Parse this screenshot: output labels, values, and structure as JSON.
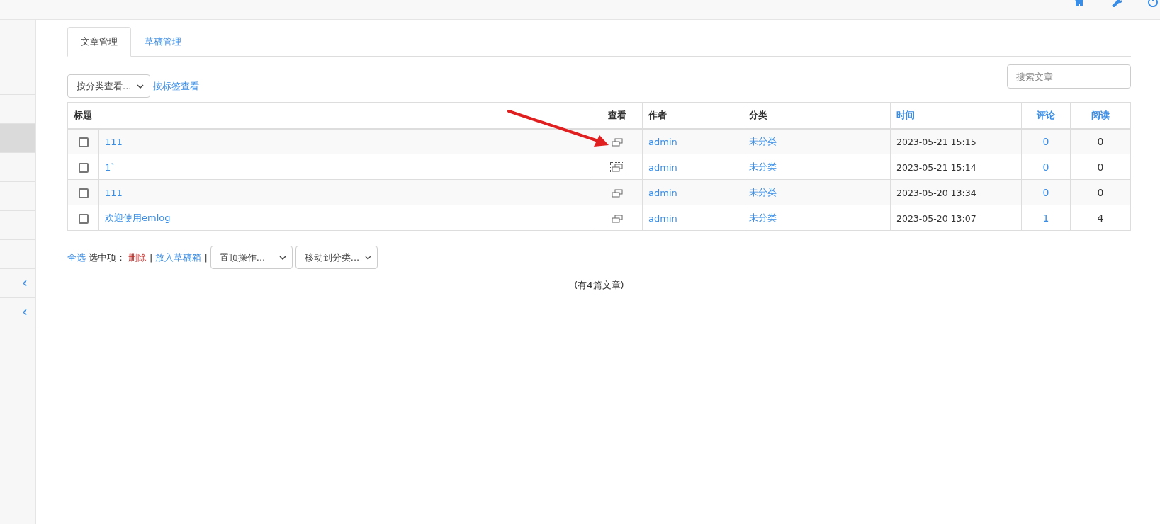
{
  "sidebar": {
    "items": [
      {
        "selected": false,
        "expandable": false
      },
      {
        "selected": true,
        "expandable": false
      },
      {
        "selected": false,
        "expandable": false
      },
      {
        "selected": false,
        "expandable": false
      },
      {
        "selected": false,
        "expandable": false
      },
      {
        "selected": false,
        "expandable": false
      },
      {
        "selected": false,
        "expandable": true
      },
      {
        "selected": false,
        "expandable": true
      }
    ]
  },
  "tabs": [
    {
      "label": "文章管理",
      "selected": true
    },
    {
      "label": "草稿管理",
      "selected": false
    }
  ],
  "filters": {
    "category_select": "按分类查看...",
    "tag_link": "按标签查看"
  },
  "search": {
    "placeholder": "搜索文章"
  },
  "table": {
    "columns": [
      {
        "label": "标题",
        "sortable": false
      },
      {
        "label": "查看",
        "sortable": false
      },
      {
        "label": "作者",
        "sortable": false
      },
      {
        "label": "分类",
        "sortable": false
      },
      {
        "label": "时间",
        "sortable": true
      },
      {
        "label": "评论",
        "sortable": true
      },
      {
        "label": "阅读",
        "sortable": true
      }
    ],
    "rows": [
      {
        "checked": false,
        "title": "111",
        "focused": false,
        "author": "admin",
        "category": "未分类",
        "time": "2023-05-21 15:15",
        "comments": "0",
        "views": "0"
      },
      {
        "checked": false,
        "title": "1`",
        "focused": true,
        "author": "admin",
        "category": "未分类",
        "time": "2023-05-21 15:14",
        "comments": "0",
        "views": "0"
      },
      {
        "checked": false,
        "title": "111",
        "focused": false,
        "author": "admin",
        "category": "未分类",
        "time": "2023-05-20 13:34",
        "comments": "0",
        "views": "0"
      },
      {
        "checked": false,
        "title": "欢迎使用emlog",
        "focused": false,
        "author": "admin",
        "category": "未分类",
        "time": "2023-05-20 13:07",
        "comments": "1",
        "views": "4"
      }
    ]
  },
  "actions": {
    "select_all": "全选",
    "selected_label": "选中项：",
    "delete": "删除",
    "separator_1": "|",
    "to_drafts": "放入草稿箱",
    "separator_2": "|",
    "top_select": "置顶操作...",
    "move_select": "移动到分类..."
  },
  "summary": "(有4篇文章)"
}
